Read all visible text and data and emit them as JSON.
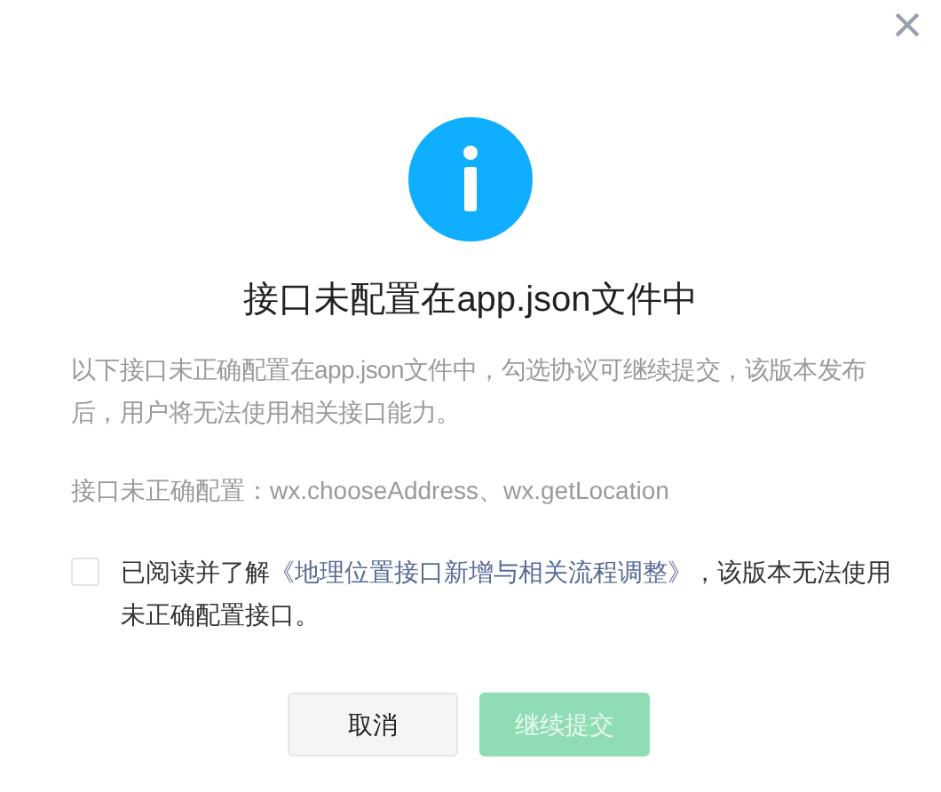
{
  "dialog": {
    "close_label": "×",
    "title": "接口未配置在app.json文件中",
    "description": "以下接口未正确配置在app.json文件中，勾选协议可继续提交，该版本发布后，用户将无法使用相关接口能力。",
    "config_note": "接口未正确配置：wx.chooseAddress、wx.getLocation",
    "agreement": {
      "checked": false,
      "prefix": "已阅读并了解",
      "link": "《地理位置接口新增与相关流程调整》",
      "suffix": "，该版本无法使用未正确配置接口。"
    },
    "buttons": [
      {
        "label": "取消",
        "kind": "secondary",
        "disabled": false
      },
      {
        "label": "继续提交",
        "kind": "primary",
        "disabled": true
      }
    ]
  }
}
